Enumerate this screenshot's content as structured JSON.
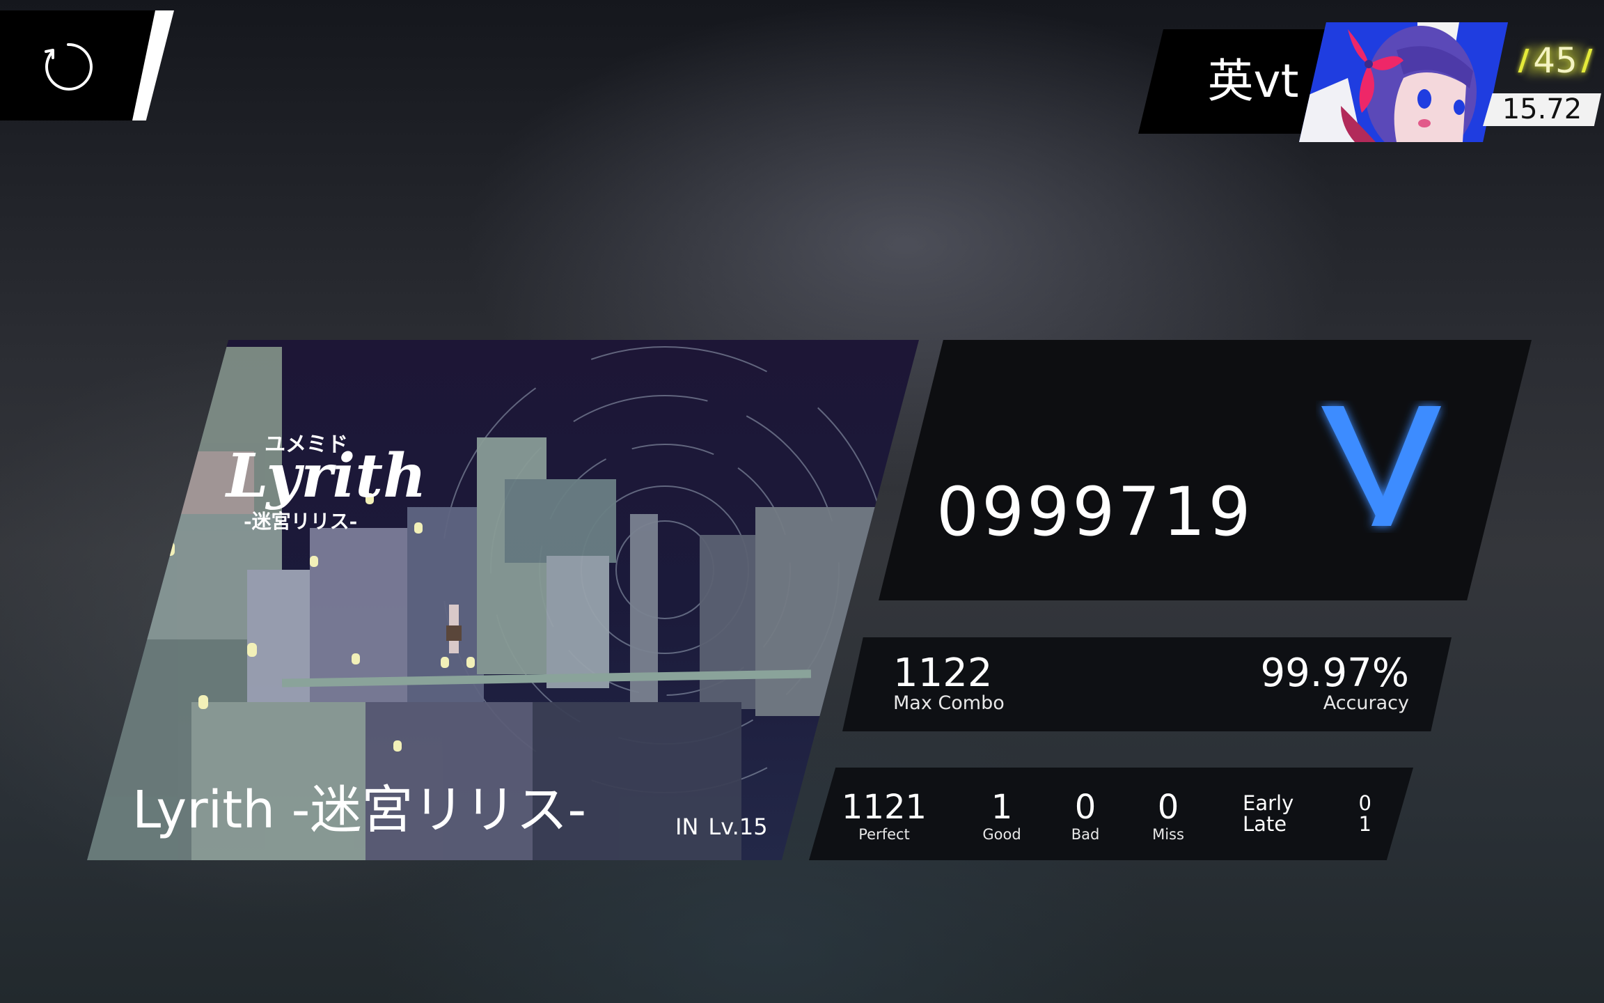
{
  "top_bar": {
    "retry_icon": "retry-icon"
  },
  "player": {
    "name": "英vt",
    "avatar_icon": "avatar-image",
    "level": "45",
    "rating": "15.72",
    "colors": {
      "level_glow": "#e4ea3a",
      "avatar_bg": "#1f3de0"
    }
  },
  "song": {
    "title": "Lyrith -迷宮リリス-",
    "difficulty": "IN",
    "level": "Lv.15",
    "jacket_logo": {
      "kana": "ユメミド",
      "title": "Lyrith",
      "subtitle": "-迷宮リリス-"
    }
  },
  "result": {
    "score": "0999719",
    "rank": "V",
    "rank_color": "#3d8cff",
    "max_combo": "1122",
    "max_combo_label": "Max Combo",
    "accuracy": "99.97%",
    "accuracy_label": "Accuracy",
    "judgements": [
      {
        "label": "Perfect",
        "value": "1121"
      },
      {
        "label": "Good",
        "value": "1"
      },
      {
        "label": "Bad",
        "value": "0"
      },
      {
        "label": "Miss",
        "value": "0"
      }
    ],
    "early_label": "Early",
    "early_value": "0",
    "late_label": "Late",
    "late_value": "1"
  }
}
